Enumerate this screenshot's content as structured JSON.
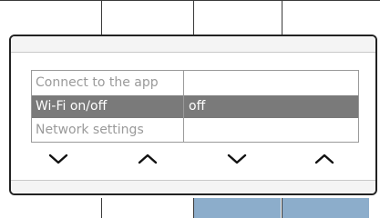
{
  "menu": {
    "items": [
      {
        "label": "Connect to the app",
        "value": ""
      },
      {
        "label": "Wi-Fi on/off",
        "value": "off",
        "selected": true
      },
      {
        "label": "Network settings",
        "value": ""
      }
    ]
  },
  "controls": [
    {
      "icon": "chevron-down-icon"
    },
    {
      "icon": "chevron-up-icon"
    },
    {
      "icon": "chevron-down-icon"
    },
    {
      "icon": "chevron-up-icon"
    }
  ],
  "colors": {
    "selected_row": "#7a7a7a",
    "tile_blue": "#8cadcb",
    "border": "#222222"
  }
}
